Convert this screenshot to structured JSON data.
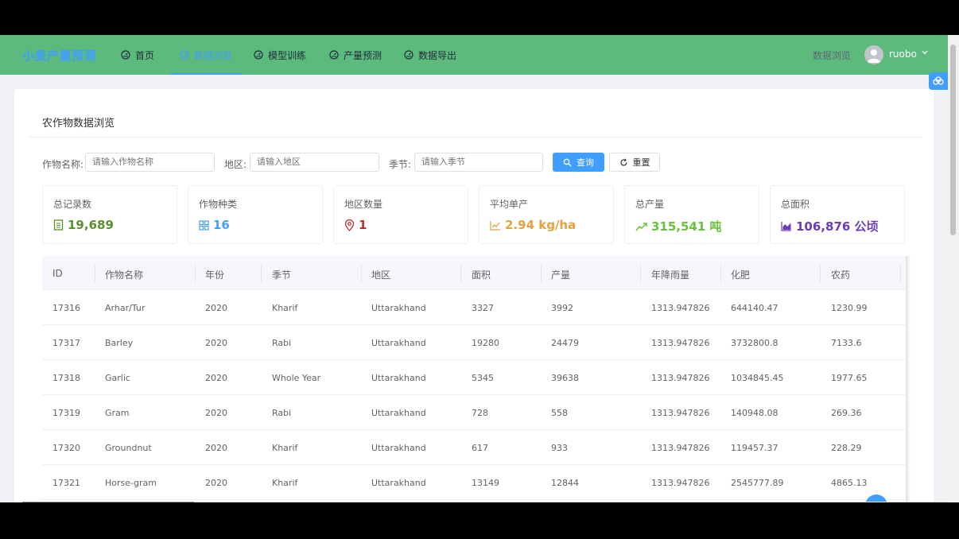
{
  "app": {
    "title": "小麦产量预测"
  },
  "nav": {
    "items": [
      {
        "label": "首页",
        "icon": "dashboard-icon"
      },
      {
        "label": "数据浏览",
        "icon": "dashboard-icon",
        "active": true
      },
      {
        "label": "模型训练",
        "icon": "dashboard-icon"
      },
      {
        "label": "产量预测",
        "icon": "dashboard-icon"
      },
      {
        "label": "数据导出",
        "icon": "dashboard-icon"
      }
    ]
  },
  "header": {
    "link_label": "数据浏览",
    "username": "ruobo"
  },
  "page": {
    "title": "农作物数据浏览"
  },
  "filters": {
    "crop_label": "作物名称:",
    "crop_placeholder": "请输入作物名称",
    "region_label": "地区:",
    "region_placeholder": "请输入地区",
    "season_label": "季节:",
    "season_placeholder": "请输入季节",
    "query_label": "查询",
    "reset_label": "重置"
  },
  "stats": [
    {
      "label": "总记录数",
      "value": "19,689",
      "color": "#5a8f2e",
      "icon": "document-icon"
    },
    {
      "label": "作物种类",
      "value": "16",
      "color": "#409eff",
      "icon": "grid-icon"
    },
    {
      "label": "地区数量",
      "value": "1",
      "color": "#b5302f",
      "icon": "location-icon"
    },
    {
      "label": "平均单产",
      "value": "2.94 kg/ha",
      "color": "#e6a23c",
      "icon": "line-chart-icon"
    },
    {
      "label": "总产量",
      "value": "315,541 吨",
      "color": "#67c23a",
      "icon": "trend-up-icon"
    },
    {
      "label": "总面积",
      "value": "106,876 公顷",
      "color": "#6a3db8",
      "icon": "area-chart-icon"
    }
  ],
  "table": {
    "columns": [
      "ID",
      "作物名称",
      "年份",
      "季节",
      "地区",
      "面积",
      "产量",
      "年降雨量",
      "化肥",
      "农药"
    ],
    "rows": [
      [
        "17316",
        "Arhar/Tur",
        "2020",
        "Kharif",
        "Uttarakhand",
        "3327",
        "3992",
        "1313.947826",
        "644140.47",
        "1230.99"
      ],
      [
        "17317",
        "Barley",
        "2020",
        "Rabi",
        "Uttarakhand",
        "19280",
        "24479",
        "1313.947826",
        "3732800.8",
        "7133.6"
      ],
      [
        "17318",
        "Garlic",
        "2020",
        "Whole Year",
        "Uttarakhand",
        "5345",
        "39638",
        "1313.947826",
        "1034845.45",
        "1977.65"
      ],
      [
        "17319",
        "Gram",
        "2020",
        "Rabi",
        "Uttarakhand",
        "728",
        "558",
        "1313.947826",
        "140948.08",
        "269.36"
      ],
      [
        "17320",
        "Groundnut",
        "2020",
        "Kharif",
        "Uttarakhand",
        "617",
        "933",
        "1313.947826",
        "119457.37",
        "228.29"
      ],
      [
        "17321",
        "Horse-gram",
        "2020",
        "Kharif",
        "Uttarakhand",
        "13149",
        "12844",
        "1313.947826",
        "2545777.89",
        "4865.13"
      ]
    ]
  },
  "colors": {
    "header_bg": "#5cba7d",
    "accent": "#409eff"
  }
}
